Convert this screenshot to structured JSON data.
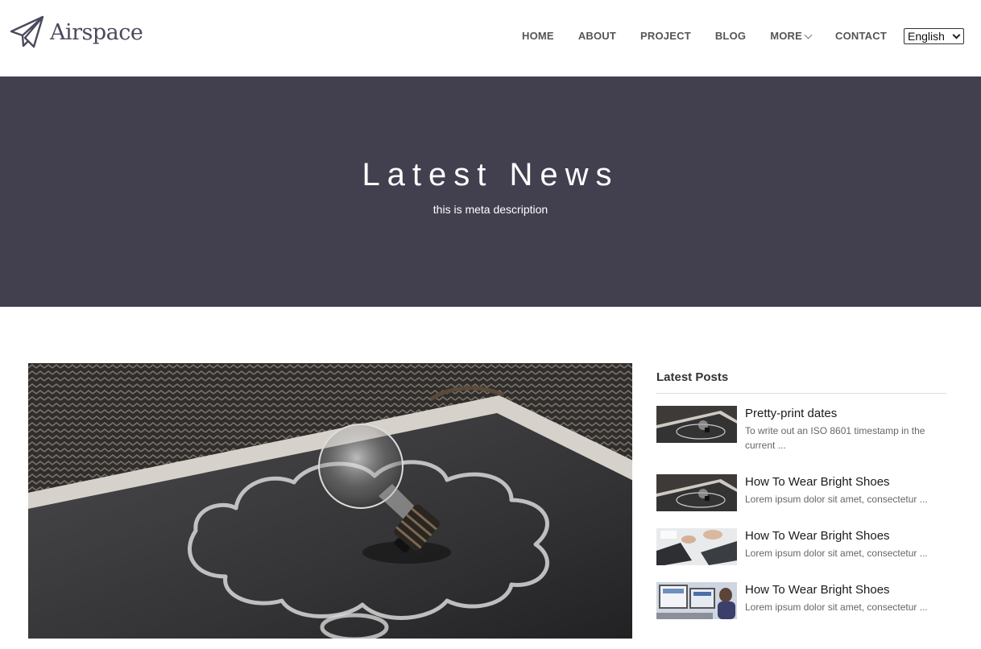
{
  "brand": {
    "name": "Airspace",
    "logo_icon": "paper-plane-icon"
  },
  "nav": {
    "items": [
      {
        "label": "HOME"
      },
      {
        "label": "ABOUT"
      },
      {
        "label": "PROJECT"
      },
      {
        "label": "BLOG"
      },
      {
        "label": "MORE",
        "icon": "chevron-down-icon"
      },
      {
        "label": "CONTACT"
      }
    ],
    "language": {
      "selected": "English"
    }
  },
  "hero": {
    "title": "Latest News",
    "description": "this is meta description",
    "background": "#42404f"
  },
  "sidebar": {
    "heading": "Latest Posts",
    "posts": [
      {
        "title": "Pretty-print dates",
        "excerpt": "To write out an ISO 8601 timestamp in the current ...",
        "thumb": "lightbulb-chalkboard-image"
      },
      {
        "title": "How To Wear Bright Shoes",
        "excerpt": "Lorem ipsum dolor sit amet, consectetur ...",
        "thumb": "lightbulb-chalkboard-image"
      },
      {
        "title": "How To Wear Bright Shoes",
        "excerpt": "Lorem ipsum dolor sit amet, consectetur ...",
        "thumb": "desk-keyboard-image"
      },
      {
        "title": "How To Wear Bright Shoes",
        "excerpt": "Lorem ipsum dolor sit amet, consectetur ...",
        "thumb": "office-monitors-image"
      }
    ]
  },
  "main": {
    "image": "lightbulb-chalkboard-image"
  }
}
